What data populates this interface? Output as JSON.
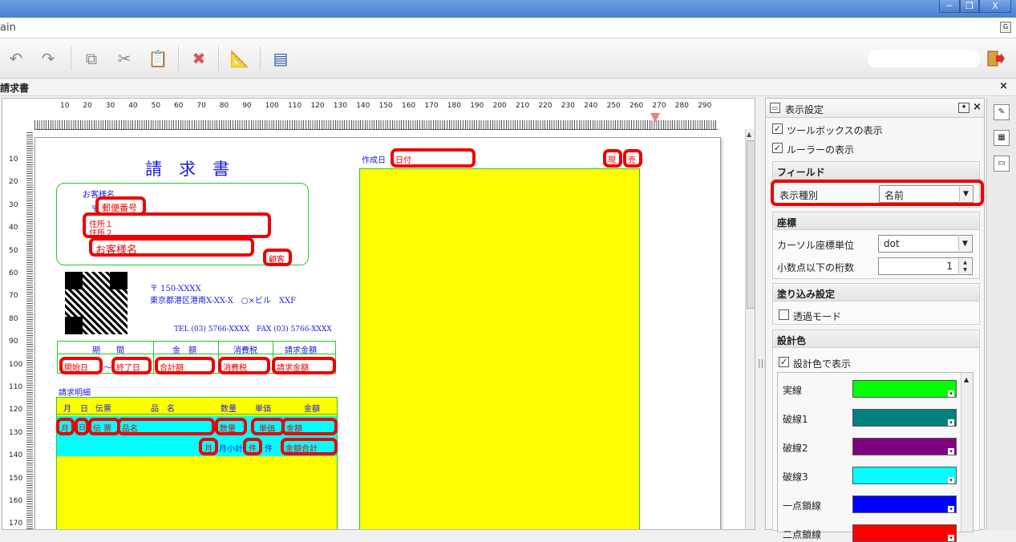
{
  "window": {
    "minimize": "─",
    "restore": "❐",
    "close": "X"
  },
  "menubar": {
    "app_text": "ain",
    "menu_icon": "G"
  },
  "toolbar": {
    "undo": "↶",
    "redo": "↷",
    "copy": "⧉",
    "cut": "✂",
    "paste": "📋",
    "delete": "✖",
    "ruler": "📐",
    "card": "▤"
  },
  "doc": {
    "title": "請求書",
    "close": "×"
  },
  "ruler": {
    "h": [
      "10",
      "20",
      "30",
      "40",
      "50",
      "60",
      "70",
      "80",
      "90",
      "100",
      "110",
      "120",
      "130",
      "140",
      "150",
      "160",
      "170",
      "180",
      "190",
      "200",
      "210",
      "220",
      "230",
      "240",
      "250",
      "260",
      "270",
      "280",
      "290"
    ],
    "v": [
      "10",
      "20",
      "30",
      "40",
      "50",
      "60",
      "70",
      "80",
      "90",
      "100",
      "110",
      "120",
      "130",
      "140",
      "150",
      "160",
      "170"
    ]
  },
  "form": {
    "title": "請　求　書",
    "customer_label": "お客様名",
    "postal_mark": "〒",
    "postal_field": "郵便番号",
    "address1": "住所１",
    "address2": "住所２",
    "customer_name": "お客様名",
    "honorific": "顧客",
    "company_postal": "〒 150-XXXX",
    "company_address": "東京都港区港南X-XX-X　○×ビル　XXF",
    "company_tel": "TEL (03) 5766-XXXX　FAX (03) 5766-XXXX",
    "date_label": "作成日",
    "date_field": "日付",
    "tag1": "現",
    "tag2": "売",
    "summary_headers": [
      "期　　間",
      "金　額",
      "消費税",
      "請求金額"
    ],
    "period_start": "開始日",
    "period_sep": "〜",
    "period_end": "終了日",
    "sum_amount": "合計額",
    "sum_tax": "消費税",
    "sum_invoice": "請求金額",
    "detail_title": "請求明細",
    "detail_headers": [
      "月",
      "日",
      "伝票",
      "品　名",
      "数量",
      "単価",
      "金額"
    ],
    "row_month": "月",
    "row_day": "日",
    "row_voucher": "伝 票",
    "row_item": "品名",
    "row_qty": "数量",
    "row_price": "単価",
    "row_amount": "金額",
    "sub_month": "月",
    "sub_label": "月小計",
    "sub_count": "件",
    "sub_count_unit": "件",
    "sub_total": "金額合計"
  },
  "panel": {
    "title": "表示設定",
    "pin": "✦",
    "close": "×",
    "show_toolbox": "ツールボックスの表示",
    "show_ruler": "ルーラーの表示",
    "field_section": "フィールド",
    "display_type_label": "表示種別",
    "display_type_value": "名前",
    "coord_section": "座標",
    "cursor_unit_label": "カーソル座標単位",
    "cursor_unit_value": "dot",
    "decimals_label": "小数点以下の桁数",
    "decimals_value": "1",
    "fill_section": "塗り込み設定",
    "transparent_mode": "透過モード",
    "design_color_section": "設計色",
    "show_design_color": "設計色で表示",
    "colors": [
      {
        "name": "実線",
        "color": "#00ff00"
      },
      {
        "name": "破線1",
        "color": "#008080"
      },
      {
        "name": "破線2",
        "color": "#800080"
      },
      {
        "name": "破線3",
        "color": "#00ffff"
      },
      {
        "name": "一点鎖線",
        "color": "#0000ff"
      },
      {
        "name": "二点鎖線",
        "color": "#ff0000"
      }
    ]
  }
}
